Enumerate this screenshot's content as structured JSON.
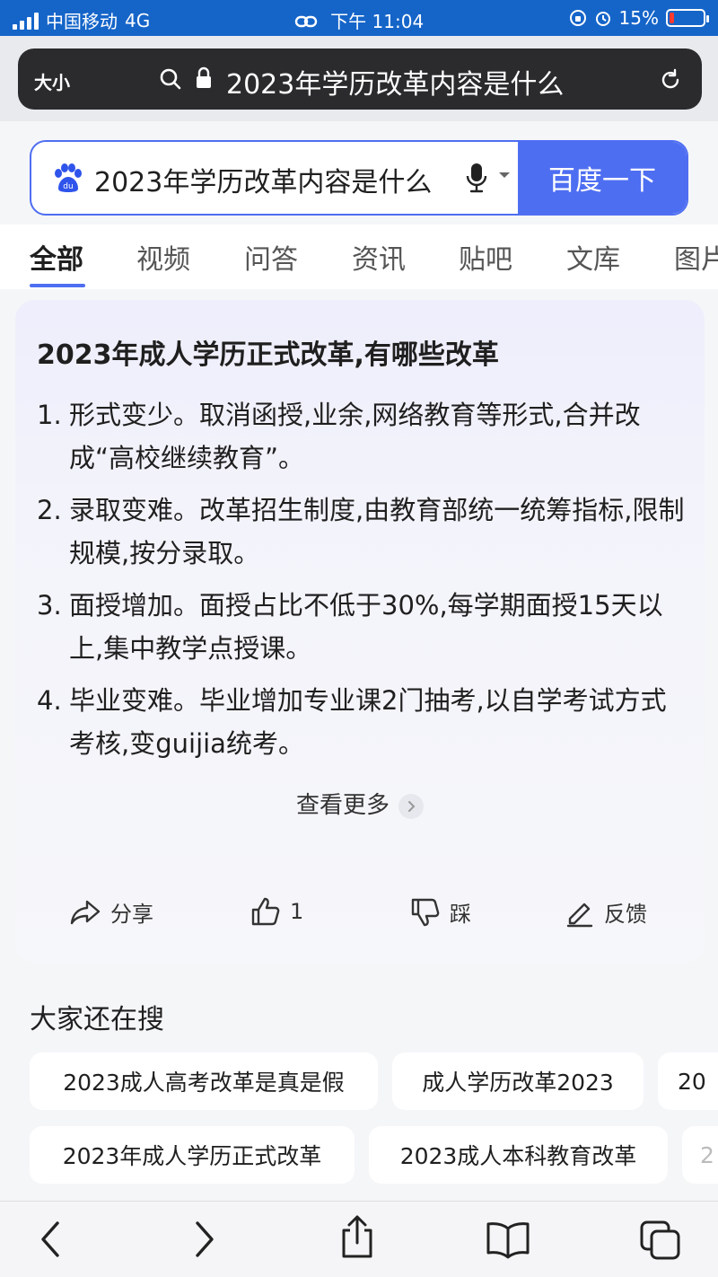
{
  "status_bar": {
    "carrier": "中国移动",
    "network": "4G",
    "time": "下午 11:04",
    "battery": "15%",
    "battery_level": 0.15
  },
  "browser": {
    "text_size_label": "大小",
    "url_text": "2023年学历改革内容是什么"
  },
  "search": {
    "query": "2023年学历改革内容是什么",
    "button_label": "百度一下"
  },
  "tabs": [
    "全部",
    "视频",
    "问答",
    "资讯",
    "贴吧",
    "文库",
    "图片"
  ],
  "answer": {
    "title": "2023年成人学历正式改革,有哪些改革",
    "items": [
      {
        "num": "1.",
        "text": "形式变少。取消函授,业余,网络教育等形式,合并改成“高校继续教育”。"
      },
      {
        "num": "2.",
        "text": "录取变难。改革招生制度,由教育部统一统筹指标,限制规模,按分录取。"
      },
      {
        "num": "3.",
        "text": "面授增加。面授占比不低于30%,每学期面授15天以上,集中教学点授课。"
      },
      {
        "num": "4.",
        "text": "毕业变难。毕业增加专业课2门抽考,以自学考试方式考核,变guijia统考。"
      }
    ],
    "more_label": "查看更多",
    "actions": {
      "share": "分享",
      "like_count": "1",
      "dislike": "踩",
      "feedback": "反馈"
    }
  },
  "related": {
    "title": "大家还在搜",
    "chips": [
      "2023成人高考改革是真是假",
      "成人学历改革2023",
      "20",
      "2023年成人学历正式改革",
      "2023成人本科教育改革",
      "2"
    ]
  },
  "colors": {
    "status_bar": "#1565c9",
    "accent": "#4e6ef2",
    "battery_low": "#ff3b30"
  }
}
